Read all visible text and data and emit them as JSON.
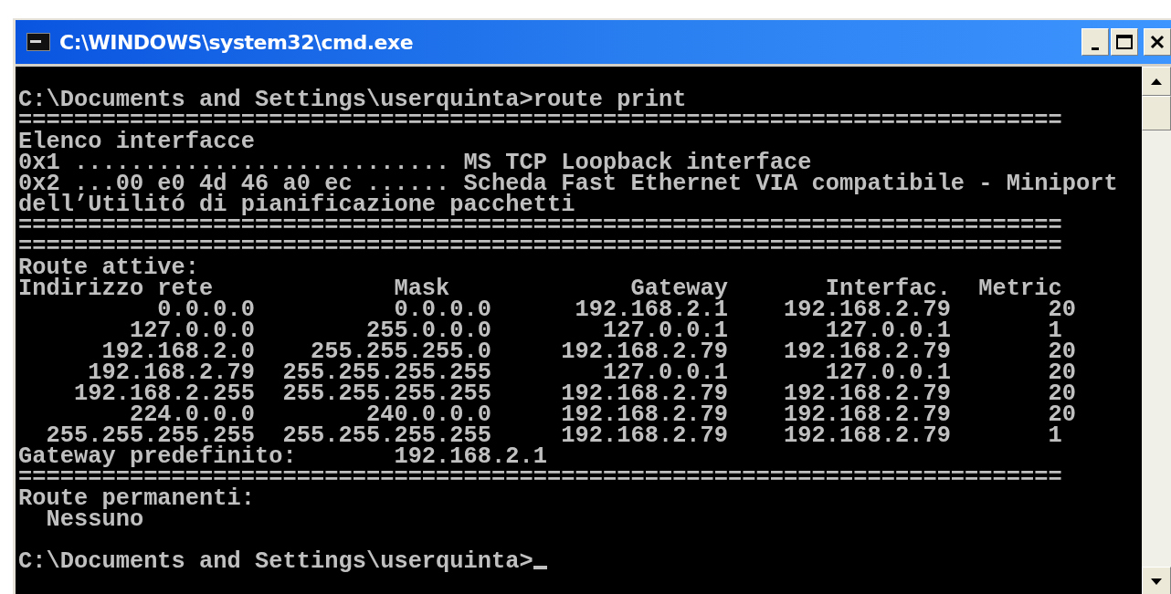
{
  "window": {
    "title": "C:\\WINDOWS\\system32\\cmd.exe"
  },
  "console": {
    "lines": [
      {
        "kind": "blank"
      },
      {
        "kind": "text",
        "text": "C:\\Documents and Settings\\userquinta>route print"
      },
      {
        "kind": "text",
        "text": "==========================================================================="
      },
      {
        "kind": "text",
        "text": "Elenco interfacce"
      },
      {
        "kind": "text",
        "text": "0x1 ........................... MS TCP Loopback interface"
      },
      {
        "kind": "text",
        "text": "0x2 ...00 e0 4d 46 a0 ec ...... Scheda Fast Ethernet VIA compatibile - Miniport"
      },
      {
        "kind": "text",
        "text": "dell’Utilitó di pianificazione pacchetti"
      },
      {
        "kind": "text",
        "text": "==========================================================================="
      },
      {
        "kind": "text",
        "text": "==========================================================================="
      },
      {
        "kind": "text",
        "text": "Route attive:"
      },
      {
        "kind": "text",
        "text": "Indirizzo rete             Mask             Gateway       Interfac.  Metric"
      },
      {
        "kind": "text",
        "text": "          0.0.0.0          0.0.0.0      192.168.2.1    192.168.2.79       20"
      },
      {
        "kind": "text",
        "text": "        127.0.0.0        255.0.0.0        127.0.0.1       127.0.0.1       1"
      },
      {
        "kind": "text",
        "text": "      192.168.2.0    255.255.255.0     192.168.2.79    192.168.2.79       20"
      },
      {
        "kind": "text",
        "text": "     192.168.2.79  255.255.255.255        127.0.0.1       127.0.0.1       20"
      },
      {
        "kind": "text",
        "text": "    192.168.2.255  255.255.255.255     192.168.2.79    192.168.2.79       20"
      },
      {
        "kind": "text",
        "text": "        224.0.0.0        240.0.0.0     192.168.2.79    192.168.2.79       20"
      },
      {
        "kind": "text",
        "text": "  255.255.255.255  255.255.255.255     192.168.2.79    192.168.2.79       1"
      },
      {
        "kind": "text",
        "text": "Gateway predefinito:       192.168.2.1"
      },
      {
        "kind": "text",
        "text": "==========================================================================="
      },
      {
        "kind": "text",
        "text": "Route permanenti:"
      },
      {
        "kind": "text",
        "text": "  Nessuno"
      },
      {
        "kind": "blank"
      },
      {
        "kind": "text",
        "text": "C:\\Documents and Settings\\userquinta>"
      }
    ]
  }
}
